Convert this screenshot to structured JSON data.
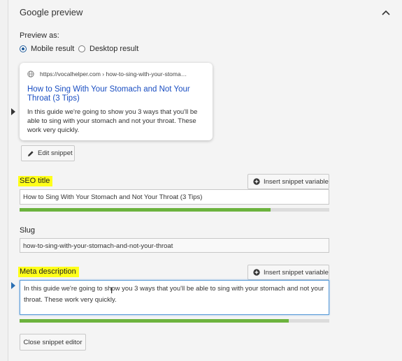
{
  "section": {
    "title": "Google preview"
  },
  "preview": {
    "label": "Preview as:",
    "options": [
      "Mobile result",
      "Desktop result"
    ],
    "selected": "Mobile result"
  },
  "card": {
    "url": "https://vocalhelper.com › how-to-sing-with-your-stoma…",
    "title": "How to Sing With Your Stomach and Not Your Throat (3 Tips)",
    "description": "In this guide we're going to show you 3 ways that you'll be able to sing with your stomach and not your throat. These work very quickly."
  },
  "buttons": {
    "edit_snippet": "Edit snippet",
    "insert_variable": "Insert snippet variable",
    "close_editor": "Close snippet editor"
  },
  "seo_title": {
    "label": "SEO title",
    "value": "How to Sing With Your Stomach and Not Your Throat (3 Tips)",
    "progress": 0.81
  },
  "slug": {
    "label": "Slug",
    "value": "how-to-sing-with-your-stomach-and-not-your-throat"
  },
  "meta_description": {
    "label": "Meta description",
    "value": "In this guide we're going to show you 3 ways that you'll be able to sing with your stomach and not your throat. These work very quickly.",
    "progress": 0.87
  },
  "colors": {
    "highlight": "#ffff1a",
    "link": "#1a4ec2",
    "progress_good": "#6cb33e",
    "focus_border": "#5b9dd9"
  }
}
